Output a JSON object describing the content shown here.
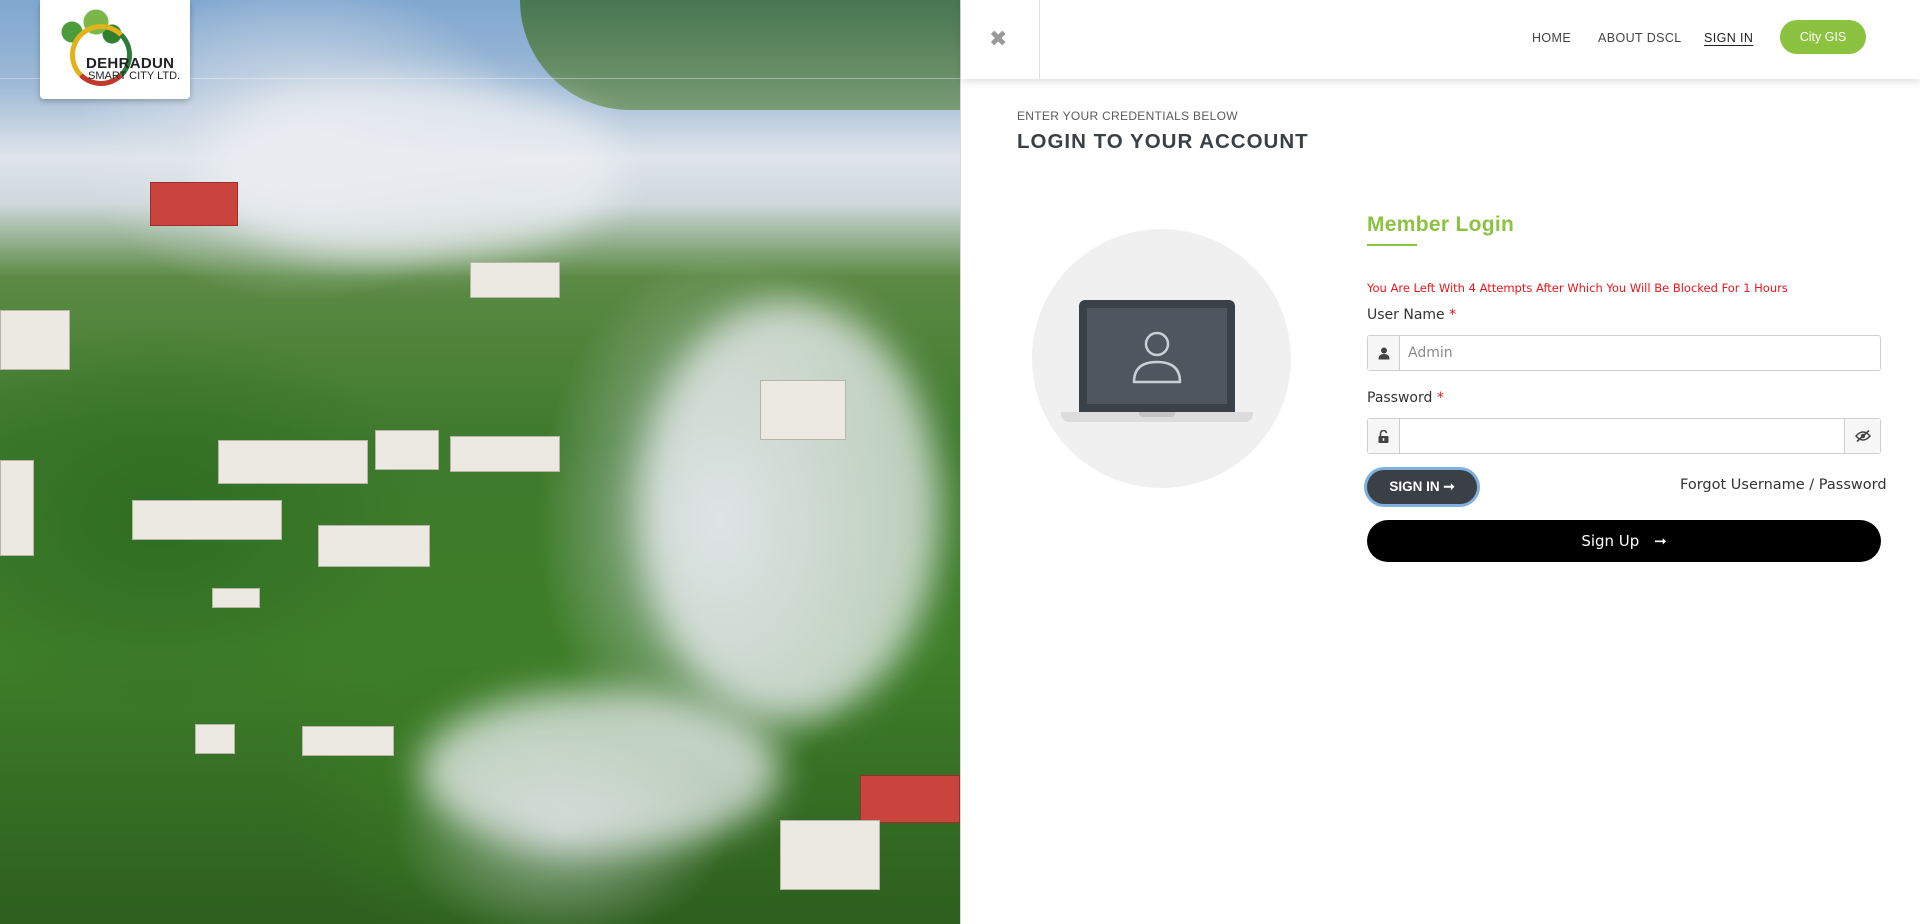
{
  "brand": {
    "line1": "DEHRADUN",
    "line2": "SMART CITY LTD."
  },
  "nav": {
    "home": "HOME",
    "about": "ABOUT DSCL",
    "signin": "SIGN IN",
    "city_gis": "City GIS"
  },
  "header": {
    "subtitle": "ENTER YOUR CREDENTIALS BELOW",
    "title": "LOGIN TO YOUR ACCOUNT"
  },
  "form": {
    "heading": "Member Login",
    "warning": "You Are Left With 4 Attempts After Which You Will Be Blocked For 1 Hours",
    "username_label": "User Name",
    "username_placeholder": "Admin",
    "username_value": "",
    "password_label": "Password",
    "password_value": "",
    "required_mark": "*",
    "signin_label": "SIGN IN",
    "forgot_label": "Forgot Username / Password",
    "signup_label": "Sign Up"
  },
  "icons": {
    "close": "close-icon",
    "user": "user-icon",
    "lock": "lock-icon",
    "eye": "eye-slash-icon",
    "arrow": "arrow-right-icon"
  },
  "colors": {
    "accent": "#8bc23f",
    "warning": "#e8161b",
    "dark_button": "#3b3f46",
    "signup": "#000000"
  }
}
